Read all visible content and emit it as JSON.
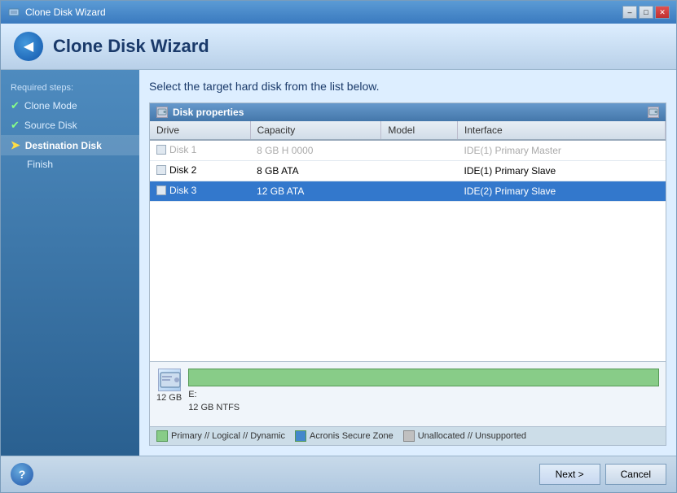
{
  "window": {
    "title": "Clone Disk Wizard",
    "controls": {
      "minimize": "–",
      "maximize": "□",
      "close": "✕"
    }
  },
  "header": {
    "title": "Clone Disk Wizard",
    "back_icon": "◀"
  },
  "sidebar": {
    "section_title": "Required steps:",
    "items": [
      {
        "id": "clone-mode",
        "label": "Clone Mode",
        "state": "done"
      },
      {
        "id": "source-disk",
        "label": "Source Disk",
        "state": "done"
      },
      {
        "id": "destination-disk",
        "label": "Destination Disk",
        "state": "current"
      },
      {
        "id": "finish",
        "label": "Finish",
        "state": "pending"
      }
    ]
  },
  "content": {
    "instruction": "Select the target hard disk from the list below.",
    "disk_properties": {
      "title": "Disk properties"
    },
    "table": {
      "columns": [
        "Drive",
        "Capacity",
        "Model",
        "Interface"
      ],
      "rows": [
        {
          "id": "disk1",
          "drive": "Disk 1",
          "capacity": "8 GB H 0000",
          "model": "",
          "interface": "IDE(1) Primary Master",
          "disabled": true,
          "selected": false
        },
        {
          "id": "disk2",
          "drive": "Disk 2",
          "capacity": "8 GB ATA",
          "model": "",
          "interface": "IDE(1) Primary Slave",
          "disabled": false,
          "selected": false
        },
        {
          "id": "disk3",
          "drive": "Disk 3",
          "capacity": "12 GB ATA",
          "model": "",
          "interface": "IDE(2) Primary Slave",
          "disabled": false,
          "selected": true
        }
      ]
    },
    "disk_preview": {
      "size": "12 GB",
      "partition_label": "E:",
      "partition_detail": "12 GB  NTFS"
    },
    "legend": {
      "items": [
        {
          "type": "green",
          "label": "Primary // Logical // Dynamic"
        },
        {
          "type": "blue",
          "label": "Acronis Secure Zone"
        },
        {
          "type": "gray",
          "label": "Unallocated // Unsupported"
        }
      ]
    }
  },
  "footer": {
    "help_icon": "?",
    "buttons": {
      "next": "Next >",
      "cancel": "Cancel"
    }
  }
}
